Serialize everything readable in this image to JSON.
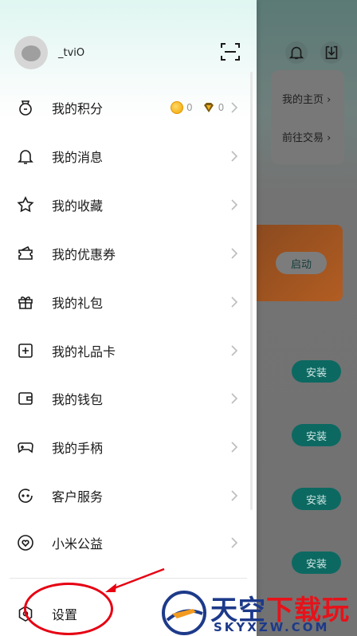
{
  "background_app": {
    "links": [
      "我的主页 ›",
      "前往交易 ›"
    ],
    "start_button": "启动",
    "install_buttons": [
      "安装",
      "安装",
      "安装",
      "安装"
    ],
    "colors": {
      "install_bg": "#0c6962",
      "banner": "#b25d22"
    }
  },
  "profile": {
    "username": "_tviO",
    "scan_icon": "scan-icon"
  },
  "points": {
    "coins": "0",
    "gems": "0"
  },
  "menu": [
    {
      "label": "我的积分",
      "icon": "points-bag-icon"
    },
    {
      "label": "我的消息",
      "icon": "bell-icon"
    },
    {
      "label": "我的收藏",
      "icon": "star-icon"
    },
    {
      "label": "我的优惠券",
      "icon": "coupon-icon"
    },
    {
      "label": "我的礼包",
      "icon": "gift-box-icon"
    },
    {
      "label": "我的礼品卡",
      "icon": "gift-card-icon"
    },
    {
      "label": "我的钱包",
      "icon": "wallet-icon"
    },
    {
      "label": "我的手柄",
      "icon": "gamepad-icon"
    },
    {
      "label": "客户服务",
      "icon": "customer-service-icon"
    },
    {
      "label": "小米公益",
      "icon": "charity-heart-icon"
    }
  ],
  "settings": {
    "label": "设置",
    "icon": "settings-hex-icon"
  },
  "watermark": {
    "main_blue": "天空",
    "main_red": "下载玩",
    "sub": "SKYXZW.COM"
  },
  "colors": {
    "annotation": "#e60012",
    "accent_gold": "#f0a500"
  }
}
